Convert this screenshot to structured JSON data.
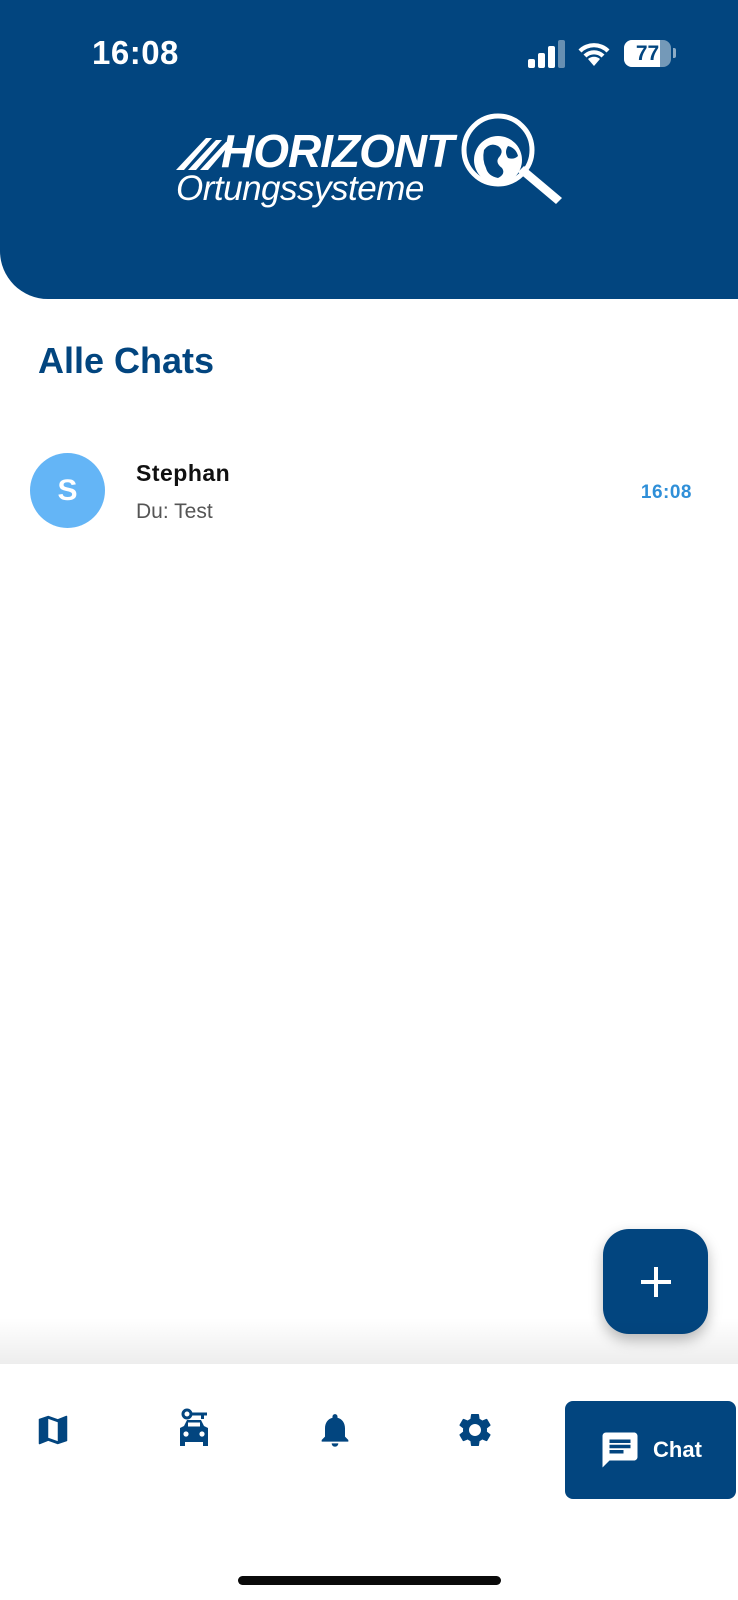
{
  "status_bar": {
    "time": "16:08",
    "battery_level": "77",
    "battery_fraction": 0.77,
    "icons": [
      "signal-icon",
      "wifi-icon",
      "battery-icon"
    ]
  },
  "header": {
    "logo_wordmark": "HORIZONT",
    "logo_subtitle": "Ortungssysteme",
    "logo_icon": "globe-magnifier-icon"
  },
  "page": {
    "title": "Alle Chats"
  },
  "chats": [
    {
      "avatar_initial": "S",
      "name": "Stephan",
      "preview": "Du: Test",
      "time": "16:08",
      "avatar_color": "#64b5f6"
    }
  ],
  "fab": {
    "icon": "plus-icon"
  },
  "bottom_nav": {
    "items": [
      {
        "icon": "map-icon",
        "label": ""
      },
      {
        "icon": "car-key-icon",
        "label": ""
      },
      {
        "icon": "bell-icon",
        "label": ""
      },
      {
        "icon": "gear-icon",
        "label": ""
      },
      {
        "icon": "chat-icon",
        "label": "Chat",
        "active": true
      }
    ]
  },
  "colors": {
    "primary": "#02457f",
    "accent_time": "#2f8fd8",
    "avatar": "#64b5f6",
    "background": "#ffffff"
  }
}
